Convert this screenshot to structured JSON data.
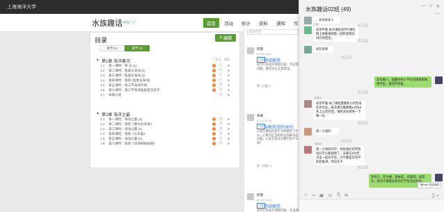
{
  "topbar": {
    "brand": "上海海洋大学"
  },
  "header": {
    "course_title": "水族趣话",
    "course_sub": "课程门户",
    "nav": [
      "首页",
      "活动",
      "统计",
      "资料",
      "通知",
      "作业",
      "考试"
    ]
  },
  "catalog": {
    "title": "目录",
    "edit_label": "编辑",
    "tabs": [
      "章节 01",
      "章节 02"
    ],
    "col_heads": [
      "学习",
      "任务"
    ],
    "chapters": [
      {
        "title": "第1章 海洋概况",
        "lessons": [
          {
            "num": "1.1",
            "title": "第一课时：导 论 (1)",
            "badge": "1",
            "done": true
          },
          {
            "num": "1.2",
            "title": "第二课时：鱼类与海洋 (2)",
            "badge": "1",
            "done": true
          },
          {
            "num": "1.3",
            "title": "第三课时：鱼类与海洋 (2)",
            "badge": "1",
            "done": true
          },
          {
            "num": "1.4",
            "title": "第四课时：观赏 (鱼类与海洋)",
            "badge": "1",
            "done": true
          },
          {
            "num": "1.5",
            "title": "第五课时：第三节海洋环境",
            "badge": "1",
            "done": false
          },
          {
            "num": "1.6",
            "title": "第六课时：第三节海洋鱼类变迁因子",
            "badge": "1",
            "done": false
          },
          {
            "num": "1.7",
            "title": "本章小结",
            "badge": "",
            "done": false
          }
        ]
      },
      {
        "title": "第2章 海洋之最",
        "lessons": [
          {
            "num": "2.1",
            "title": "第一课时：海洋之最 (1)",
            "badge": "1",
            "done": false
          },
          {
            "num": "2.2",
            "title": "第二课时：观赏《鲁尔的深海》",
            "badge": "1",
            "done": false
          },
          {
            "num": "2.3",
            "title": "第三课时：海洋之最 (2)",
            "badge": "1",
            "done": false
          },
          {
            "num": "2.4",
            "title": "第四课时：观赏《大白鲨》",
            "badge": "1",
            "done": false
          },
          {
            "num": "2.5",
            "title": "第五课时：海洋之最 (3)",
            "badge": "1",
            "done": false
          },
          {
            "num": "2.6",
            "title": "第六课时：观赏《深海探秘视频》",
            "badge": "1",
            "done": false
          }
        ]
      }
    ]
  },
  "feed": {
    "search_placeholder": "新证在前",
    "posts": [
      {
        "name": "邱慧",
        "time": "02-24 23:22",
        "tag": "讨论",
        "title": "答疑解惑",
        "body": "同学们有关于课程内容、作业等问题，都可以在这里提出。",
        "stats": "赞 1  回复 6"
      },
      {
        "name": "梁峰",
        "time": "02-11 13:29",
        "tag": "讨论",
        "title": "指教我孩的深间",
        "body": "1.说在课程内容学习中遇到了什么，2.我们应当如何设法解决这个问题，3.关于海洋与我们有什么联系？",
        "stats": "赞 1  回复 11"
      },
      {
        "name": "邱慧",
        "time": "02-24 23:22",
        "tag": "讨论",
        "title": "答疑解惑",
        "body": "同学们有关于课程内容、作业等问题，都可以在这里提出。",
        "stats": ""
      }
    ]
  },
  "chat": {
    "title": "水族趣话02班 (49)",
    "controls": [
      "—",
      "□",
      "✕"
    ],
    "messages": [
      {
        "side": "in",
        "sender": "",
        "text": "，总有很多人"
      },
      {
        "side": "in",
        "sender": "学委",
        "text": "非常平看 本次课程同学们都在网上观看视频第一回的星期天问问你回答。"
      },
      {
        "side": "in",
        "sender": "",
        "text": "好的老师"
      },
      {
        "side": "out",
        "sender": "",
        "text": "没有看人，提醒你各小学任何讲受客网课学生，请同学积极。"
      },
      {
        "side": "in",
        "sender": "TA助手",
        "text": "非常平看 本门课程需要各小时完成任务作业，每次课大概要看12到15条上以后空回，请各求你提供一下哪一也"
      },
      {
        "side": "in",
        "sender": "",
        "text": "第一小组的"
      },
      {
        "side": "in",
        "sender": "TA助手",
        "text": "第一小组的同学，你处理好后带各位同学以看视频了，未能在8月后点击一起同学后，万学都是可同学的积极讲，你也先干"
      },
      {
        "side": "out",
        "sender": "",
        "text": "罗梓宁，邓文惠，蔡依廷，成蓉琪，赵琪乐，韩鸿不要提前等你们学生完成所有。"
      }
    ],
    "timestamps": [
      "09:48",
      "09:49",
      "09:50",
      "10:12",
      "10:18",
      "10:26",
      "10:31"
    ],
    "toolbar_icons": [
      "☺",
      "✂",
      "▣",
      "☏",
      "⎘",
      "✉"
    ],
    "tail": "⌚ ▾",
    "send_hint": "按Enter 发送消息"
  }
}
